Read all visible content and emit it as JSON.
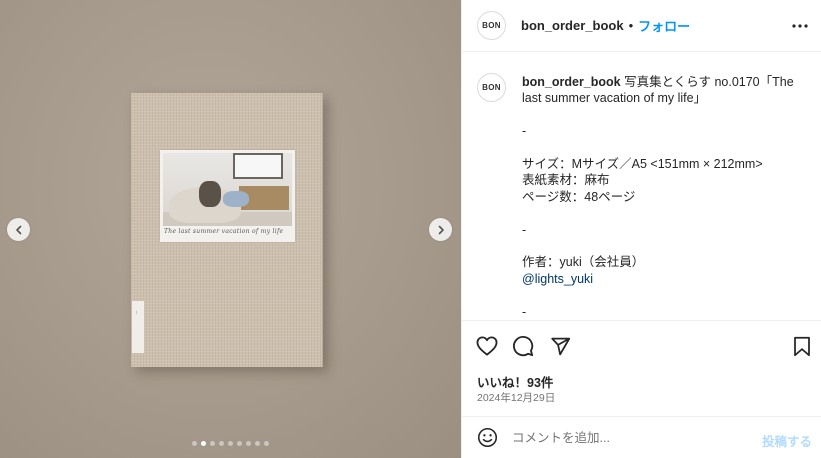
{
  "media": {
    "photo_caption": "The last summer vacation of my life",
    "carousel": {
      "count": 9,
      "active_index": 1
    }
  },
  "header": {
    "avatar_text": "BON",
    "username": "bon_order_book",
    "separator": "•",
    "follow_label": "フォロー"
  },
  "caption": {
    "avatar_text": "BON",
    "username": "bon_order_book",
    "lines": [
      " 写真集とくらす no.0170「The last summer vacation of my life」\n\n-\n\nサイズ：Mサイズ／A5 <151mm × 212mm>\n表紙素材：麻布\nページ数：48ページ\n\n-\n\n作者：yuki（会社員）\n",
      "@lights_yuki",
      "\n\n-"
    ]
  },
  "actions": {
    "likes_text": "いいね！93件",
    "date_text": "2024年12月29日"
  },
  "comment": {
    "placeholder": "コメントを追加...",
    "post_label": "投稿する"
  },
  "icons": {
    "like": "heart-icon",
    "comment": "comment-icon",
    "share": "send-icon",
    "save": "bookmark-icon",
    "emoji": "smiley-icon",
    "more": "more-dots-icon"
  },
  "colors": {
    "accent": "#0095f6",
    "post_button": "#b3dbff",
    "mention": "#00376b",
    "muted": "#737373"
  }
}
